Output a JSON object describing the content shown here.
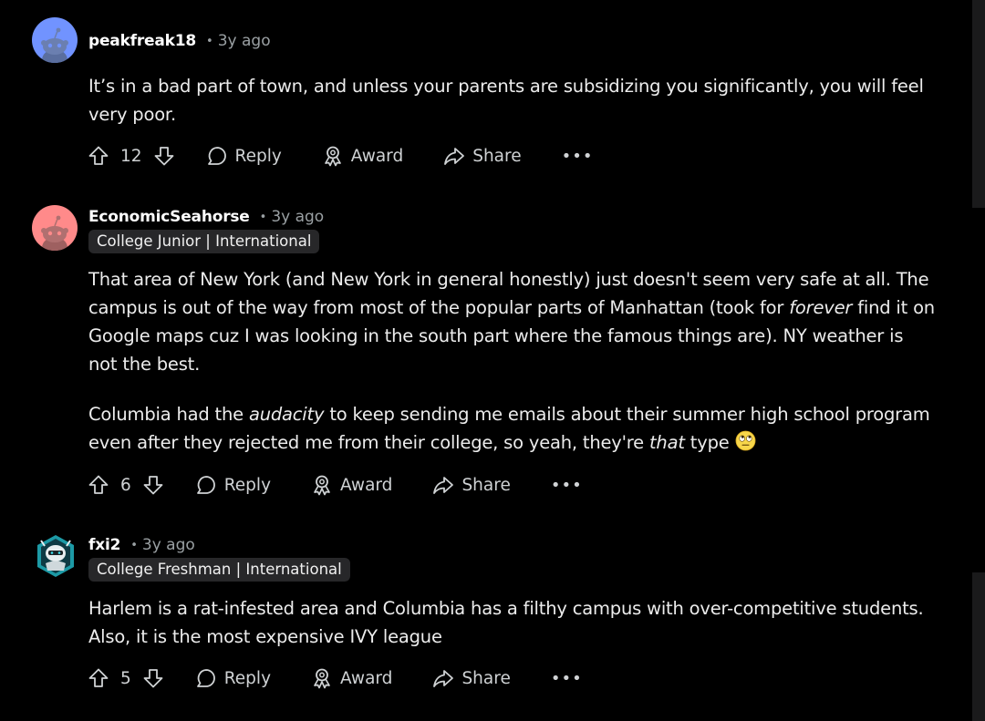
{
  "comments": [
    {
      "username": "peakfreak18",
      "time": "3y ago",
      "flair": "",
      "avatar_color": "#7193ff",
      "paragraphs": [
        "It’s in a bad part of town, and unless your parents are subsidizing you significantly, you will feel very poor."
      ],
      "votes": "12"
    },
    {
      "username": "EconomicSeahorse",
      "time": "3y ago",
      "flair": "College Junior | International",
      "avatar_color": "#ff8a8a",
      "paragraph_1": {
        "text": "That area of New York (and New York in general honestly) just doesn't seem very safe at all. The campus is out of the way from most of the popular parts of Manhattan (took for ",
        "emphasis": "forever",
        "after": " find it on Google maps cuz I was looking in the south part where the famous things are). NY weather is not the best."
      },
      "paragraph_2": {
        "text": "Columbia had the ",
        "emphasis_1": "audacity",
        "middle": " to keep sending me emails about their summer high school program even after they rejected me from their college, so yeah, they're ",
        "emphasis_2": "that",
        "after": " type",
        "emoji": "eye-roll-emoji"
      },
      "votes": "6"
    },
    {
      "username": "fxi2",
      "time": "3y ago",
      "flair": "College Freshman | International",
      "avatar_color": "#2ab8c4",
      "paragraphs": [
        "Harlem is a rat-infested area and Columbia has a filthy campus with over-competitive students. Also, it is the most expensive IVY league"
      ],
      "votes": "5"
    }
  ],
  "actions": {
    "reply": "Reply",
    "award": "Award",
    "share": "Share",
    "more": "•••"
  },
  "separator": "•",
  "icons": {
    "upvote": "upvote-arrow-icon",
    "downvote": "downvote-arrow-icon",
    "reply": "speech-bubble-icon",
    "award": "award-ribbon-icon",
    "share": "share-arrow-icon",
    "more": "ellipsis-icon"
  }
}
